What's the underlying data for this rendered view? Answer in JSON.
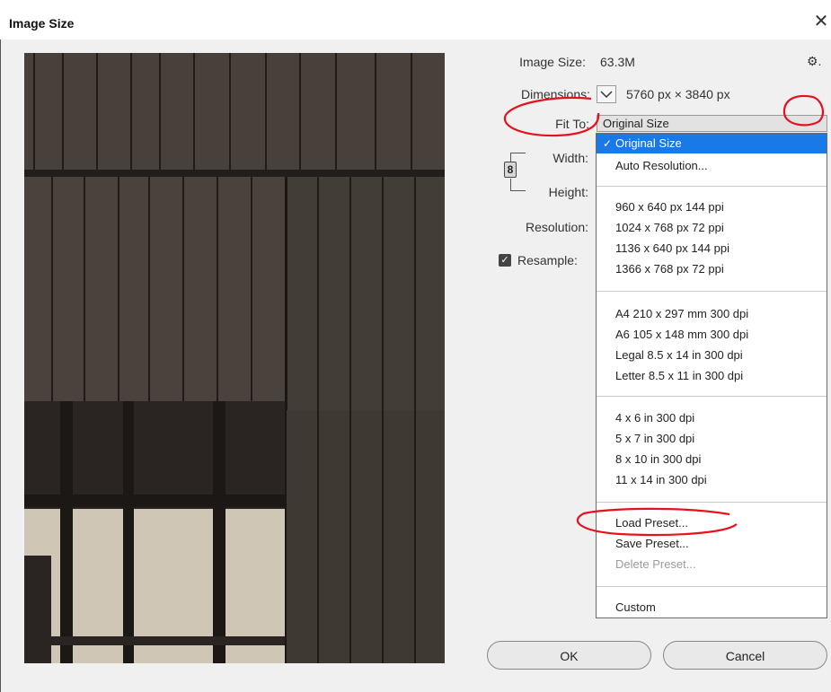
{
  "window": {
    "title": "Image Size",
    "close_glyph": "✕"
  },
  "info": {
    "image_size_label": "Image Size:",
    "image_size_value": "63.3M",
    "gear_glyph": "⚙.",
    "dimensions_label": "Dimensions:",
    "dimensions_value": "5760 px  ×  3840 px",
    "fit_to_label": "Fit To:",
    "fit_to_value": "Original Size",
    "width_label": "Width:",
    "height_label": "Height:",
    "resolution_label": "Resolution:",
    "resample_label": "Resample:",
    "resample_checked": true
  },
  "menu": {
    "groups": [
      [
        "Original Size",
        "Auto Resolution..."
      ],
      [
        "960 x 640 px 144 ppi",
        "1024 x 768 px 72 ppi",
        "1136 x 640 px 144 ppi",
        "1366 x 768 px 72 ppi"
      ],
      [
        "A4 210 x 297 mm 300 dpi",
        "A6 105 x 148 mm 300 dpi",
        "Legal 8.5 x 14 in 300 dpi",
        "Letter 8.5 x 11 in 300 dpi"
      ],
      [
        "4 x 6 in 300 dpi",
        "5 x 7 in 300 dpi",
        "8 x 10 in 300 dpi",
        "11 x 14 in 300 dpi"
      ],
      [
        "Load Preset...",
        "Save Preset...",
        "Delete Preset..."
      ],
      [
        "Custom"
      ]
    ],
    "selected": "Original Size",
    "disabled": [
      "Delete Preset..."
    ]
  },
  "buttons": {
    "ok": "OK",
    "cancel": "Cancel"
  },
  "colors": {
    "selection": "#1979e6",
    "annotation": "#e8101c"
  }
}
